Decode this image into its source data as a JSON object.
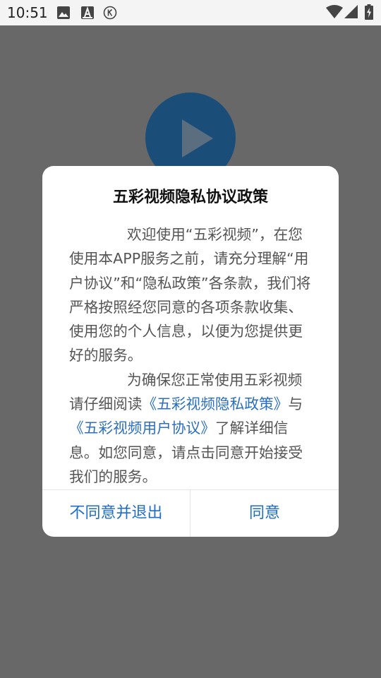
{
  "status_bar": {
    "time": "10:51",
    "left_icons": [
      "image-icon",
      "a-icon",
      "k-circle-icon"
    ],
    "right_icons": [
      "wifi-icon",
      "signal-icon",
      "battery-charging-icon"
    ]
  },
  "background": {
    "icon": "play-icon",
    "accent_color": "#1a4d78"
  },
  "dialog": {
    "title": "五彩视频隐私协议政策",
    "para1": "欢迎使用“五彩视频”，在您使用本APP服务之前，请充分理解“用户协议”和“隐私政策”各条款，我们将严格按照经您同意的各项条款收集、使用您的个人信息，以便为您提供更好的服务。",
    "para2_prefix": "为确保您正常使用五彩视频请仔细阅读",
    "link_privacy": "《五彩视频隐私政策》",
    "para2_mid": "与",
    "link_user": "《五彩视频用户协议》",
    "para2_suffix": "了解详细信息。如您同意，请点击同意开始接受我们的服务。",
    "btn_disagree": "不同意并退出",
    "btn_agree": "同意",
    "link_color": "#2b6fc0",
    "button_color": "#1e6ec8"
  }
}
